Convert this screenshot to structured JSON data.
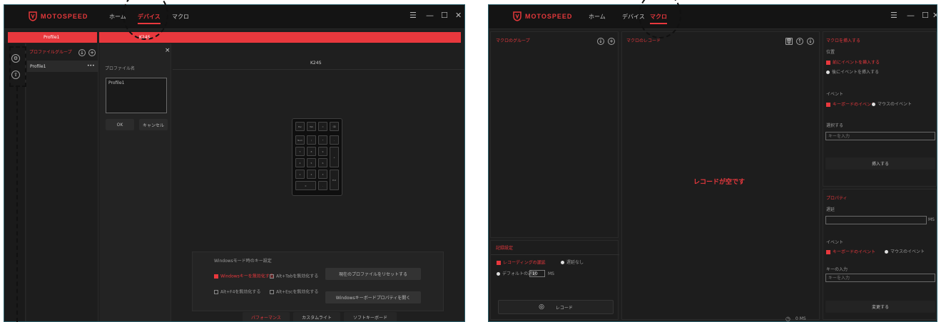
{
  "left": {
    "app_name": "MOTOSPEED",
    "nav": {
      "home": "ホーム",
      "device": "デバイス",
      "macro": "マクロ"
    },
    "window_controls": {
      "menu": "☰",
      "minimize": "—",
      "maximize": "☐",
      "close": "✕"
    },
    "profile_tab": "Profile1",
    "device_tab": "K24S",
    "profile_group_label": "プロファイルグループ",
    "profile_item": "Profile1",
    "profile_item_more": "•••",
    "rename": {
      "close": "×",
      "label": "プロファイル名",
      "value": "Profile1",
      "ok": "OK",
      "cancel": "キャンセル"
    },
    "device_name": "K24S",
    "options": {
      "title": "Windowsモード時のキー設定",
      "opt1": "Windowsキーを無効化する",
      "opt2": "Alt+Tabを無効化する",
      "opt3": "Alt+F4を無効化する",
      "opt4": "Alt+Escを無効化する",
      "btn_reset": "現在のプロファイルをリセットする",
      "btn_windows": "Windowsキーボードプロパティを開く"
    },
    "bottom_tabs": [
      "パフォーマンス",
      "カスタムライト",
      "ソフトキーボード"
    ],
    "keys": [
      "Esc",
      "Tab",
      "=",
      "⌫",
      "Num",
      "/",
      "*",
      "-",
      "7",
      "8",
      "9",
      "+",
      "4",
      "5",
      "6",
      "1",
      "2",
      "3",
      "Ent",
      "0",
      "."
    ]
  },
  "right": {
    "app_name": "MOTOSPEED",
    "nav": {
      "home": "ホーム",
      "device": "デバイス",
      "macro": "マクロ"
    },
    "window_controls": {
      "menu": "☰",
      "minimize": "—",
      "maximize": "☐",
      "close": "✕"
    },
    "macro_group_label": "マクロのグループ",
    "record_label": "マクロのレコード",
    "empty_text": "レコードが空です",
    "insert_panel": {
      "title": "マクロを挿入する",
      "position_label": "位置",
      "pos_before": "前にイベントを挿入する",
      "pos_after": "後にイベントを挿入する",
      "event_label": "イベント",
      "ev_key": "キーボードのイベント",
      "ev_mouse": "マウスのイベント",
      "input_label": "選択する",
      "input_placeholder": "キーを入力",
      "insert_button": "挿入する"
    },
    "property_panel": {
      "title": "プロパティ",
      "delay_label": "遅延",
      "delay_unit": "MS",
      "event_label": "イベント",
      "ev_key": "キーボードのイベント",
      "ev_mouse": "マウスのイベント",
      "key_label": "キーの入力",
      "key_placeholder": "キーを入力",
      "save_button": "変更する"
    },
    "settings": {
      "title": "記録設定",
      "record_delay": "レコーディングの遅延",
      "no_delay": "遅延なし",
      "default_delay": "デフォルトの遅延",
      "default_value": "10",
      "unit": "MS"
    },
    "record_button": "レコード",
    "time_value": "0 MS"
  },
  "colors": {
    "accent": "#e8383d",
    "panel": "#1f1f1f",
    "titlebar": "#141414"
  }
}
